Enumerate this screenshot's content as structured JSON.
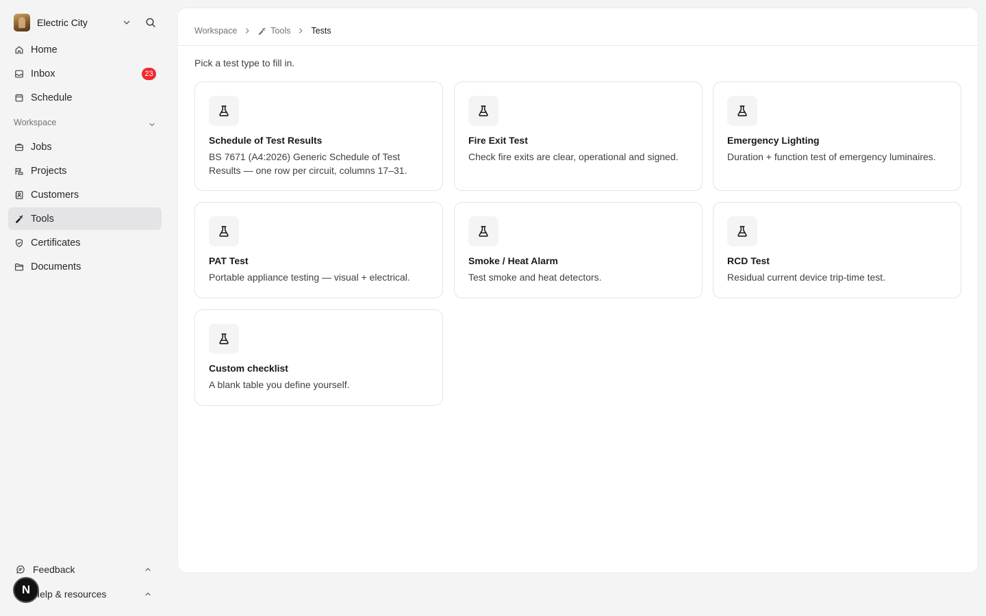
{
  "sidebar": {
    "team_name": "Electric City",
    "nav": [
      {
        "label": "Home",
        "icon": "home-icon"
      },
      {
        "label": "Inbox",
        "icon": "inbox-icon",
        "badge": "23"
      },
      {
        "label": "Schedule",
        "icon": "calendar-icon"
      }
    ],
    "workspace_label": "Workspace",
    "workspace_items": [
      {
        "label": "Jobs",
        "icon": "briefcase-icon"
      },
      {
        "label": "Projects",
        "icon": "projects-icon"
      },
      {
        "label": "Customers",
        "icon": "contacts-icon"
      },
      {
        "label": "Tools",
        "icon": "wrench-icon",
        "active": true
      },
      {
        "label": "Certificates",
        "icon": "shield-check-icon"
      },
      {
        "label": "Documents",
        "icon": "folder-icon"
      }
    ],
    "feedback_label": "Feedback",
    "help_label": "Help & resources",
    "logo_letter": "N"
  },
  "breadcrumb": {
    "items": [
      "Workspace",
      "Tools",
      "Tests"
    ]
  },
  "main": {
    "intro": "Pick a test type to fill in.",
    "cards": [
      {
        "title": "Schedule of Test Results",
        "description": "BS 7671 (A4:2026) Generic Schedule of Test Results — one row per circuit, columns 17–31.",
        "icon": "flask-icon"
      },
      {
        "title": "Fire Exit Test",
        "description": "Check fire exits are clear, operational and signed.",
        "icon": "flask-icon"
      },
      {
        "title": "Emergency Lighting",
        "description": "Duration + function test of emergency luminaires.",
        "icon": "flask-icon"
      },
      {
        "title": "PAT Test",
        "description": "Portable appliance testing — visual + electrical.",
        "icon": "flask-icon"
      },
      {
        "title": "Smoke / Heat Alarm",
        "description": "Test smoke and heat detectors.",
        "icon": "flask-icon"
      },
      {
        "title": "RCD Test",
        "description": "Residual current device trip-time test.",
        "icon": "flask-icon"
      },
      {
        "title": "Custom checklist",
        "description": "A blank table you define yourself.",
        "icon": "flask-icon"
      }
    ]
  },
  "colors": {
    "badge": "#ef2b2d",
    "active_nav_bg": "#e4e4e7",
    "background": "#f4f4f5"
  }
}
